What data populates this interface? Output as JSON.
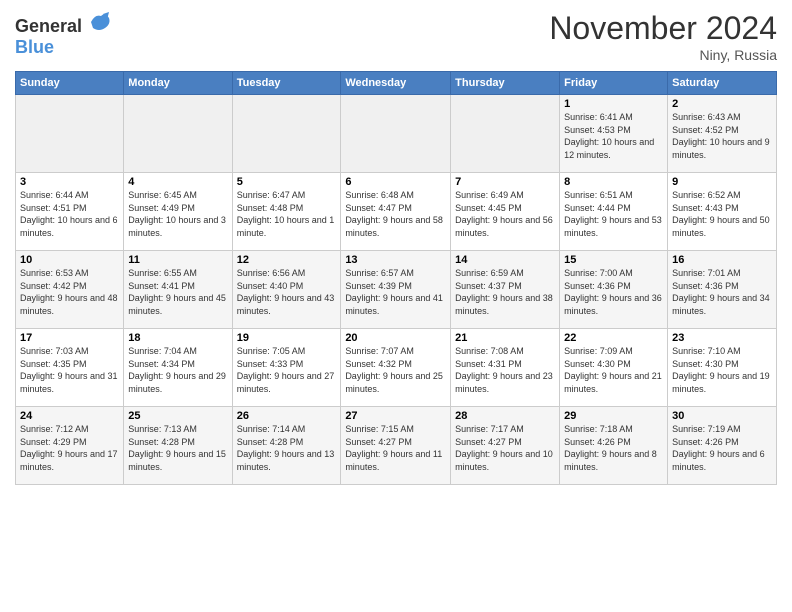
{
  "header": {
    "logo_general": "General",
    "logo_blue": "Blue",
    "month_title": "November 2024",
    "location": "Niny, Russia"
  },
  "weekdays": [
    "Sunday",
    "Monday",
    "Tuesday",
    "Wednesday",
    "Thursday",
    "Friday",
    "Saturday"
  ],
  "weeks": [
    [
      {
        "day": "",
        "sunrise": "",
        "sunset": "",
        "daylight": ""
      },
      {
        "day": "",
        "sunrise": "",
        "sunset": "",
        "daylight": ""
      },
      {
        "day": "",
        "sunrise": "",
        "sunset": "",
        "daylight": ""
      },
      {
        "day": "",
        "sunrise": "",
        "sunset": "",
        "daylight": ""
      },
      {
        "day": "",
        "sunrise": "",
        "sunset": "",
        "daylight": ""
      },
      {
        "day": "1",
        "sunrise": "Sunrise: 6:41 AM",
        "sunset": "Sunset: 4:53 PM",
        "daylight": "Daylight: 10 hours and 12 minutes."
      },
      {
        "day": "2",
        "sunrise": "Sunrise: 6:43 AM",
        "sunset": "Sunset: 4:52 PM",
        "daylight": "Daylight: 10 hours and 9 minutes."
      }
    ],
    [
      {
        "day": "3",
        "sunrise": "Sunrise: 6:44 AM",
        "sunset": "Sunset: 4:51 PM",
        "daylight": "Daylight: 10 hours and 6 minutes."
      },
      {
        "day": "4",
        "sunrise": "Sunrise: 6:45 AM",
        "sunset": "Sunset: 4:49 PM",
        "daylight": "Daylight: 10 hours and 3 minutes."
      },
      {
        "day": "5",
        "sunrise": "Sunrise: 6:47 AM",
        "sunset": "Sunset: 4:48 PM",
        "daylight": "Daylight: 10 hours and 1 minute."
      },
      {
        "day": "6",
        "sunrise": "Sunrise: 6:48 AM",
        "sunset": "Sunset: 4:47 PM",
        "daylight": "Daylight: 9 hours and 58 minutes."
      },
      {
        "day": "7",
        "sunrise": "Sunrise: 6:49 AM",
        "sunset": "Sunset: 4:45 PM",
        "daylight": "Daylight: 9 hours and 56 minutes."
      },
      {
        "day": "8",
        "sunrise": "Sunrise: 6:51 AM",
        "sunset": "Sunset: 4:44 PM",
        "daylight": "Daylight: 9 hours and 53 minutes."
      },
      {
        "day": "9",
        "sunrise": "Sunrise: 6:52 AM",
        "sunset": "Sunset: 4:43 PM",
        "daylight": "Daylight: 9 hours and 50 minutes."
      }
    ],
    [
      {
        "day": "10",
        "sunrise": "Sunrise: 6:53 AM",
        "sunset": "Sunset: 4:42 PM",
        "daylight": "Daylight: 9 hours and 48 minutes."
      },
      {
        "day": "11",
        "sunrise": "Sunrise: 6:55 AM",
        "sunset": "Sunset: 4:41 PM",
        "daylight": "Daylight: 9 hours and 45 minutes."
      },
      {
        "day": "12",
        "sunrise": "Sunrise: 6:56 AM",
        "sunset": "Sunset: 4:40 PM",
        "daylight": "Daylight: 9 hours and 43 minutes."
      },
      {
        "day": "13",
        "sunrise": "Sunrise: 6:57 AM",
        "sunset": "Sunset: 4:39 PM",
        "daylight": "Daylight: 9 hours and 41 minutes."
      },
      {
        "day": "14",
        "sunrise": "Sunrise: 6:59 AM",
        "sunset": "Sunset: 4:37 PM",
        "daylight": "Daylight: 9 hours and 38 minutes."
      },
      {
        "day": "15",
        "sunrise": "Sunrise: 7:00 AM",
        "sunset": "Sunset: 4:36 PM",
        "daylight": "Daylight: 9 hours and 36 minutes."
      },
      {
        "day": "16",
        "sunrise": "Sunrise: 7:01 AM",
        "sunset": "Sunset: 4:36 PM",
        "daylight": "Daylight: 9 hours and 34 minutes."
      }
    ],
    [
      {
        "day": "17",
        "sunrise": "Sunrise: 7:03 AM",
        "sunset": "Sunset: 4:35 PM",
        "daylight": "Daylight: 9 hours and 31 minutes."
      },
      {
        "day": "18",
        "sunrise": "Sunrise: 7:04 AM",
        "sunset": "Sunset: 4:34 PM",
        "daylight": "Daylight: 9 hours and 29 minutes."
      },
      {
        "day": "19",
        "sunrise": "Sunrise: 7:05 AM",
        "sunset": "Sunset: 4:33 PM",
        "daylight": "Daylight: 9 hours and 27 minutes."
      },
      {
        "day": "20",
        "sunrise": "Sunrise: 7:07 AM",
        "sunset": "Sunset: 4:32 PM",
        "daylight": "Daylight: 9 hours and 25 minutes."
      },
      {
        "day": "21",
        "sunrise": "Sunrise: 7:08 AM",
        "sunset": "Sunset: 4:31 PM",
        "daylight": "Daylight: 9 hours and 23 minutes."
      },
      {
        "day": "22",
        "sunrise": "Sunrise: 7:09 AM",
        "sunset": "Sunset: 4:30 PM",
        "daylight": "Daylight: 9 hours and 21 minutes."
      },
      {
        "day": "23",
        "sunrise": "Sunrise: 7:10 AM",
        "sunset": "Sunset: 4:30 PM",
        "daylight": "Daylight: 9 hours and 19 minutes."
      }
    ],
    [
      {
        "day": "24",
        "sunrise": "Sunrise: 7:12 AM",
        "sunset": "Sunset: 4:29 PM",
        "daylight": "Daylight: 9 hours and 17 minutes."
      },
      {
        "day": "25",
        "sunrise": "Sunrise: 7:13 AM",
        "sunset": "Sunset: 4:28 PM",
        "daylight": "Daylight: 9 hours and 15 minutes."
      },
      {
        "day": "26",
        "sunrise": "Sunrise: 7:14 AM",
        "sunset": "Sunset: 4:28 PM",
        "daylight": "Daylight: 9 hours and 13 minutes."
      },
      {
        "day": "27",
        "sunrise": "Sunrise: 7:15 AM",
        "sunset": "Sunset: 4:27 PM",
        "daylight": "Daylight: 9 hours and 11 minutes."
      },
      {
        "day": "28",
        "sunrise": "Sunrise: 7:17 AM",
        "sunset": "Sunset: 4:27 PM",
        "daylight": "Daylight: 9 hours and 10 minutes."
      },
      {
        "day": "29",
        "sunrise": "Sunrise: 7:18 AM",
        "sunset": "Sunset: 4:26 PM",
        "daylight": "Daylight: 9 hours and 8 minutes."
      },
      {
        "day": "30",
        "sunrise": "Sunrise: 7:19 AM",
        "sunset": "Sunset: 4:26 PM",
        "daylight": "Daylight: 9 hours and 6 minutes."
      }
    ]
  ]
}
